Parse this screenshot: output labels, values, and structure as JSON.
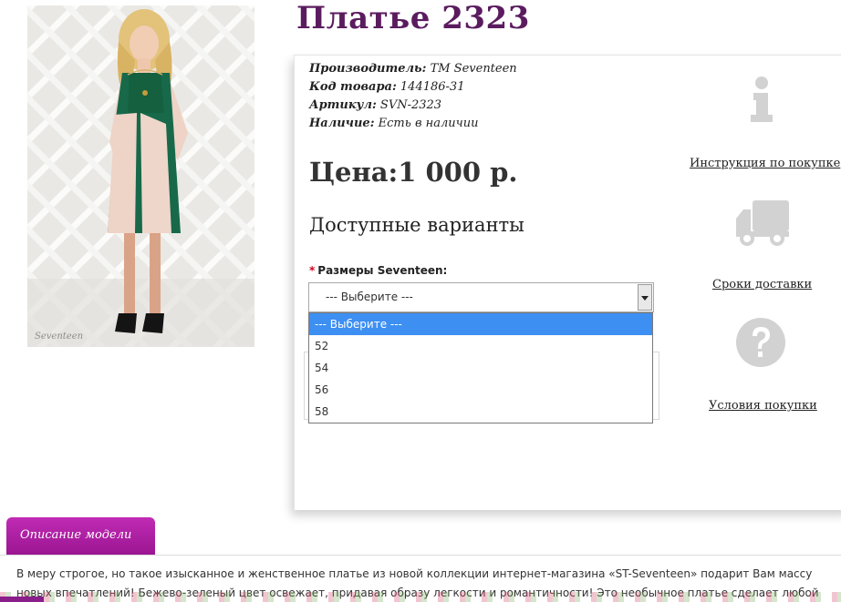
{
  "product": {
    "title": "Платье 2323",
    "photo_watermark": "Seventeen"
  },
  "meta": {
    "manufacturer_label": "Производитель:",
    "manufacturer_value": "ТМ Seventeen",
    "code_label": "Код товара:",
    "code_value": "144186-31",
    "sku_label": "Артикул:",
    "sku_value": "SVN-2323",
    "stock_label": "Наличие:",
    "stock_value": "Есть в наличии"
  },
  "price": "Цена:1 000 р.",
  "variants": {
    "title": "Доступные варианты",
    "required_mark": "*",
    "size_label": "Размеры Seventeen:",
    "selected": "--- Выберите ---",
    "options": [
      "--- Выберите ---",
      "52",
      "54",
      "56",
      "58"
    ]
  },
  "side": {
    "instructions_icon": "info-icon",
    "instructions_link": "Инструкция по покупке",
    "delivery_icon": "truck-icon",
    "delivery_link": "Сроки доставки",
    "terms_icon": "question-icon",
    "terms_link": "Условия покупки"
  },
  "description": {
    "tab_label": "Описание модели",
    "line1": "В меру строгое, но такое изысканное и женственное платье из новой коллекции интернет-магазина «ST-Seventeen» подарит Вам массу",
    "line2": "новых впечатлений! Бежево-зеленый цвет освежает, придавая образу легкости и романтичности! Это необычное платье сделает любой"
  },
  "colors": {
    "title": "#5b1c5f",
    "tab": "#b020a8",
    "selected_option": "#3d8ff2",
    "icon_gray": "#d2d2d2"
  }
}
